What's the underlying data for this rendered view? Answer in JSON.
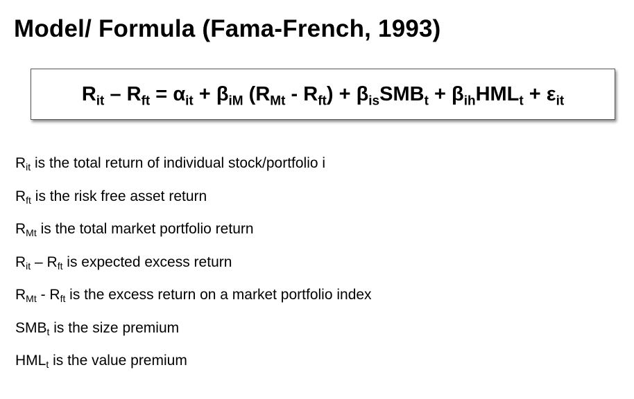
{
  "slide": {
    "title": "Model/ Formula (Fama-French, 1993)"
  },
  "formula": {
    "r1": "R",
    "r1_sub": "it",
    "op1": " – ",
    "r2": "R",
    "r2_sub": "ft",
    "op2": " = ",
    "alpha": "α",
    "alpha_sub": "it",
    "op3": " + ",
    "beta1": "β",
    "beta1_sub": "iM",
    "paren_open": " (",
    "r3": "R",
    "r3_sub": "Mt",
    "op4": " - ",
    "r4": "R",
    "r4_sub": "ft",
    "paren_close": ")",
    "op5": " + ",
    "beta2": "β",
    "beta2_sub": "is",
    "smb": "SMB",
    "smb_sub": "t",
    "op6": " + ",
    "beta3": "β",
    "beta3_sub": "ih",
    "hml": "HML",
    "hml_sub": "t",
    "op7": " + ",
    "eps": "ε",
    "eps_sub": "it"
  },
  "definitions": [
    {
      "sym": "R",
      "sub": "it",
      "text": " is the total return of individual stock/portfolio i"
    },
    {
      "sym": "R",
      "sub": "ft",
      "text": " is the risk free asset return"
    },
    {
      "sym": "R",
      "sub": "Mt",
      "text": " is the total market portfolio return"
    },
    {
      "sym": "R",
      "sub": "it",
      "mid": " – R",
      "sub2": "ft",
      "text": " is expected excess return"
    },
    {
      "sym": "R",
      "sub": "Mt",
      "mid": " - R",
      "sub2": "ft",
      "text": " is the excess return on a market portfolio index"
    },
    {
      "sym": "SMB",
      "sub": "t",
      "text": " is the size premium"
    },
    {
      "sym": "HML",
      "sub": "t",
      "text": " is the value premium"
    }
  ]
}
